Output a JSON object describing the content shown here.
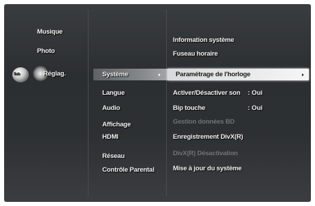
{
  "left_menu": {
    "music": "Musique",
    "photo": "Photo",
    "settings": "Réglag.",
    "disc": "Sub"
  },
  "category_menu": {
    "items": [
      "Système",
      "Langue",
      "Audio",
      "Affichage",
      "HDMI",
      "Réseau",
      "Contrôle Parental"
    ],
    "selected": "Système"
  },
  "options_menu": {
    "system_info": "Information système",
    "timezone": "Fuseau horaire",
    "clock_setting": "Paramétrage de l'horloge",
    "sound_toggle_label": "Activer/Désactiver son",
    "sound_toggle_value": ": Oui",
    "beep_label": "Bip touche",
    "beep_value": ": Oui",
    "bd_data": "Gestion données BD",
    "divx_register": "Enregistrement DivX(R)",
    "divx_deactivate": "DivX(R) Désactivation",
    "system_update": "Mise à jour du système"
  }
}
